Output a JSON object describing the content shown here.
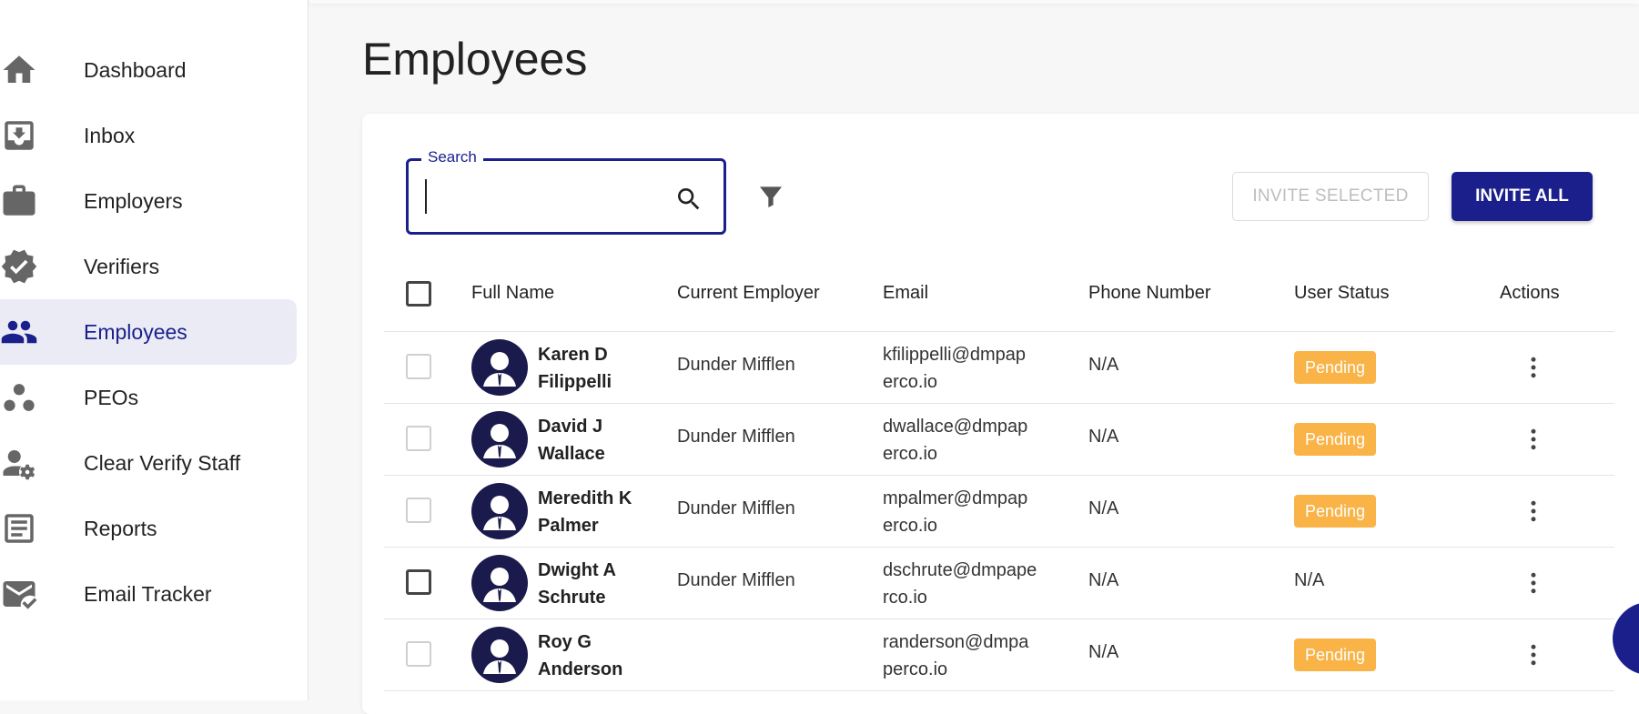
{
  "sidebar": {
    "items": [
      {
        "label": "Dashboard",
        "icon": "home-icon"
      },
      {
        "label": "Inbox",
        "icon": "inbox-icon"
      },
      {
        "label": "Employers",
        "icon": "briefcase-icon"
      },
      {
        "label": "Verifiers",
        "icon": "verified-badge-icon"
      },
      {
        "label": "Employees",
        "icon": "people-icon",
        "active": true
      },
      {
        "label": "PEOs",
        "icon": "bubble-chart-icon"
      },
      {
        "label": "Clear Verify Staff",
        "icon": "user-gear-icon"
      },
      {
        "label": "Reports",
        "icon": "report-icon"
      },
      {
        "label": "Email Tracker",
        "icon": "mail-check-icon"
      }
    ]
  },
  "page": {
    "title": "Employees"
  },
  "search": {
    "label": "Search",
    "value": "",
    "placeholder": ""
  },
  "toolbar": {
    "invite_selected_label": "INVITE SELECTED",
    "invite_all_label": "INVITE ALL"
  },
  "table": {
    "headers": {
      "full_name": "Full Name",
      "current_employer": "Current Employer",
      "email": "Email",
      "phone": "Phone Number",
      "user_status": "User Status",
      "actions": "Actions"
    },
    "rows": [
      {
        "first": "Karen D",
        "last": "Filippelli",
        "employer": "Dunder Mifflen",
        "email_1": "kfilippelli@dmpap",
        "email_2": "erco.io",
        "phone": "N/A",
        "status": "Pending"
      },
      {
        "first": "David J",
        "last": "Wallace",
        "employer": "Dunder Mifflen",
        "email_1": "dwallace@dmpap",
        "email_2": "erco.io",
        "phone": "N/A",
        "status": "Pending"
      },
      {
        "first": "Meredith K",
        "last": "Palmer",
        "employer": "Dunder Mifflen",
        "email_1": "mpalmer@dmpap",
        "email_2": "erco.io",
        "phone": "N/A",
        "status": "Pending"
      },
      {
        "first": "Dwight A",
        "last": "Schrute",
        "employer": "Dunder Mifflen",
        "email_1": "dschrute@dmpape",
        "email_2": "rco.io",
        "phone": "N/A",
        "status": "N/A"
      },
      {
        "first": "Roy G",
        "last": "Anderson",
        "employer": "",
        "email_1": "randerson@dmpa",
        "email_2": "perco.io",
        "phone": "N/A",
        "status": "Pending"
      }
    ]
  },
  "colors": {
    "brand": "#1a1f8c",
    "pending": "#f9b347",
    "active_nav_bg": "#ebebf6"
  }
}
